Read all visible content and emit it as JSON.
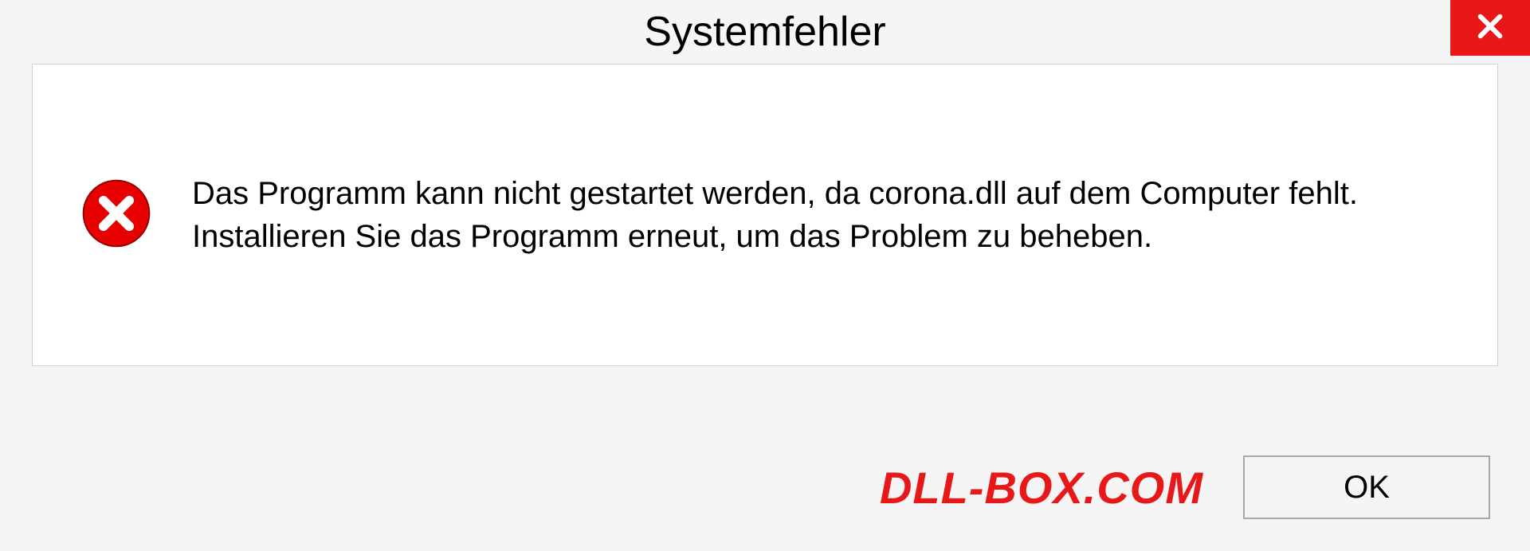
{
  "dialog": {
    "title": "Systemfehler",
    "message": "Das Programm kann nicht gestartet werden, da corona.dll auf dem Computer fehlt. Installieren Sie das Programm erneut, um das Problem zu beheben.",
    "ok_label": "OK"
  },
  "watermark": {
    "text": "DLL-BOX.COM"
  }
}
